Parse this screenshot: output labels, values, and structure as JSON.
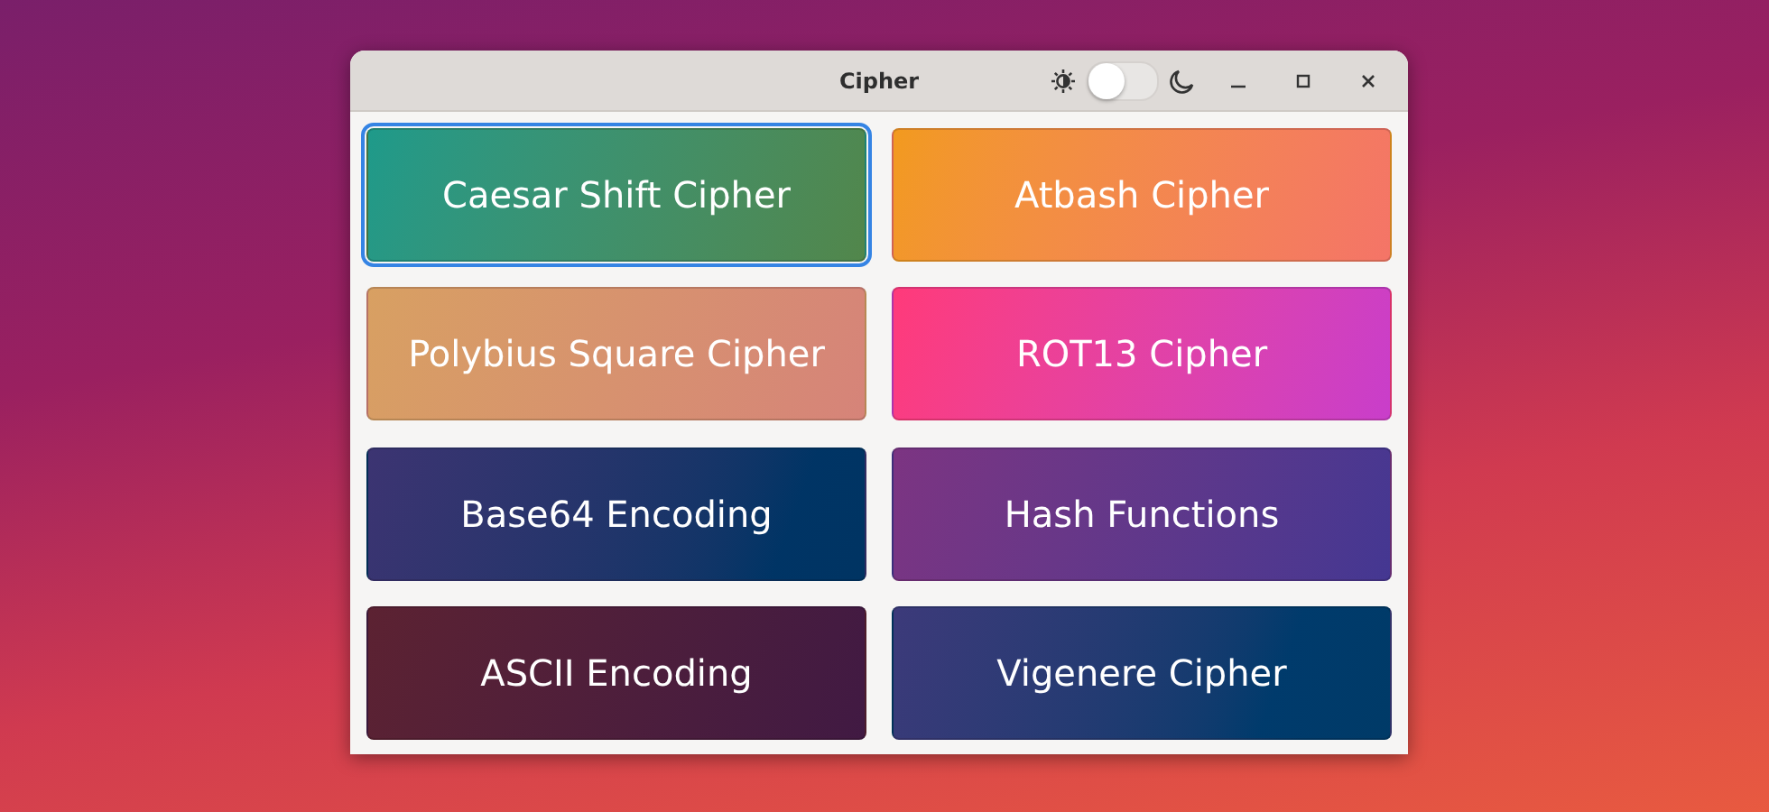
{
  "window": {
    "title": "Cipher"
  },
  "theme_switch": {
    "on": false
  },
  "cards": [
    {
      "label": "Caesar Shift Cipher",
      "selected": true,
      "color": "#1e9a8a"
    },
    {
      "label": "Atbash Cipher",
      "selected": false,
      "color": "#f29a1e"
    },
    {
      "label": "Polybius Square Cipher",
      "selected": false,
      "color": "#d8a062"
    },
    {
      "label": "ROT13 Cipher",
      "selected": false,
      "color": "#ff3a7a"
    },
    {
      "label": "Base64 Encoding",
      "selected": false,
      "color": "#3c3472"
    },
    {
      "label": "Hash Functions",
      "selected": false,
      "color": "#7c3482"
    },
    {
      "label": "ASCII Encoding",
      "selected": false,
      "color": "#5c2232"
    },
    {
      "label": "Vigenere Cipher",
      "selected": false,
      "color": "#3c3a7a"
    }
  ]
}
